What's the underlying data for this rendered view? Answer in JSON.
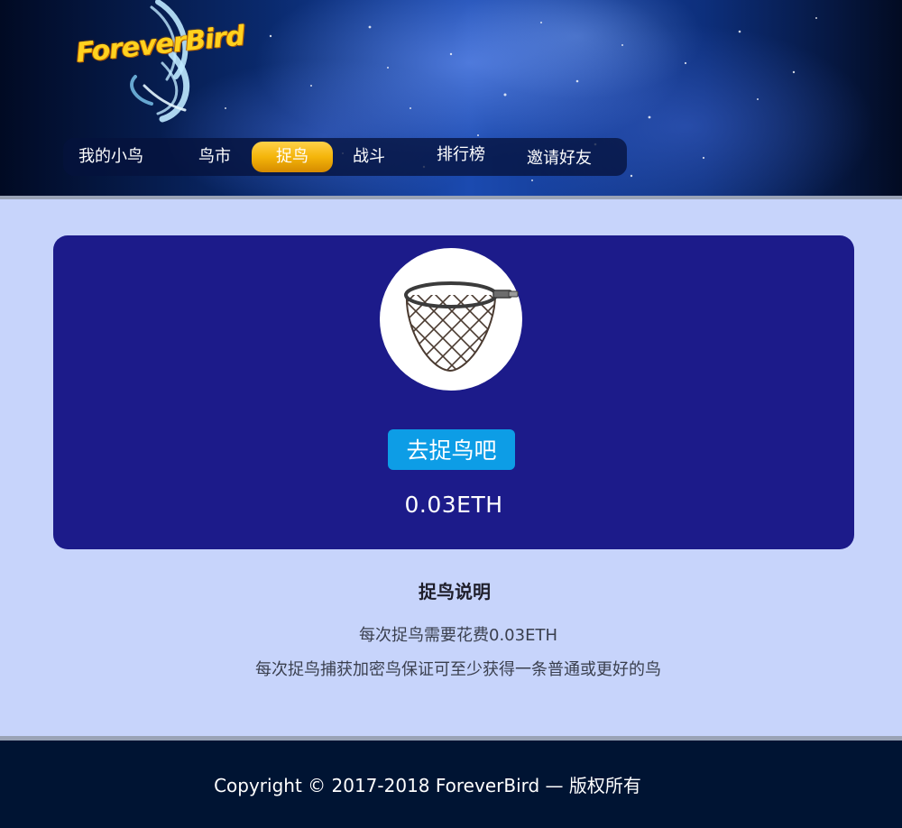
{
  "header": {
    "logo_text": "ForeverBird"
  },
  "nav": {
    "items": [
      {
        "label": "我的小鸟"
      },
      {
        "label": "鸟市"
      },
      {
        "label": "捉鸟",
        "active": true
      },
      {
        "label": "战斗"
      },
      {
        "label": "排行榜"
      },
      {
        "label": "邀请好友"
      }
    ],
    "active_color": "#f4b50a"
  },
  "card": {
    "image_icon": "catching-net-icon",
    "button_label": "去捉鸟吧",
    "price": "0.03ETH",
    "background": "#1c1b8a",
    "button_color": "#0d9de6"
  },
  "instructions": {
    "title": "捉鸟说明",
    "lines": [
      "每次捉鸟需要花费0.03ETH",
      "每次捉鸟捕获加密鸟保证可至少获得一条普通或更好的鸟"
    ]
  },
  "footer": {
    "copyright": "Copyright © 2017-2018 ForeverBird — 版权所有"
  }
}
